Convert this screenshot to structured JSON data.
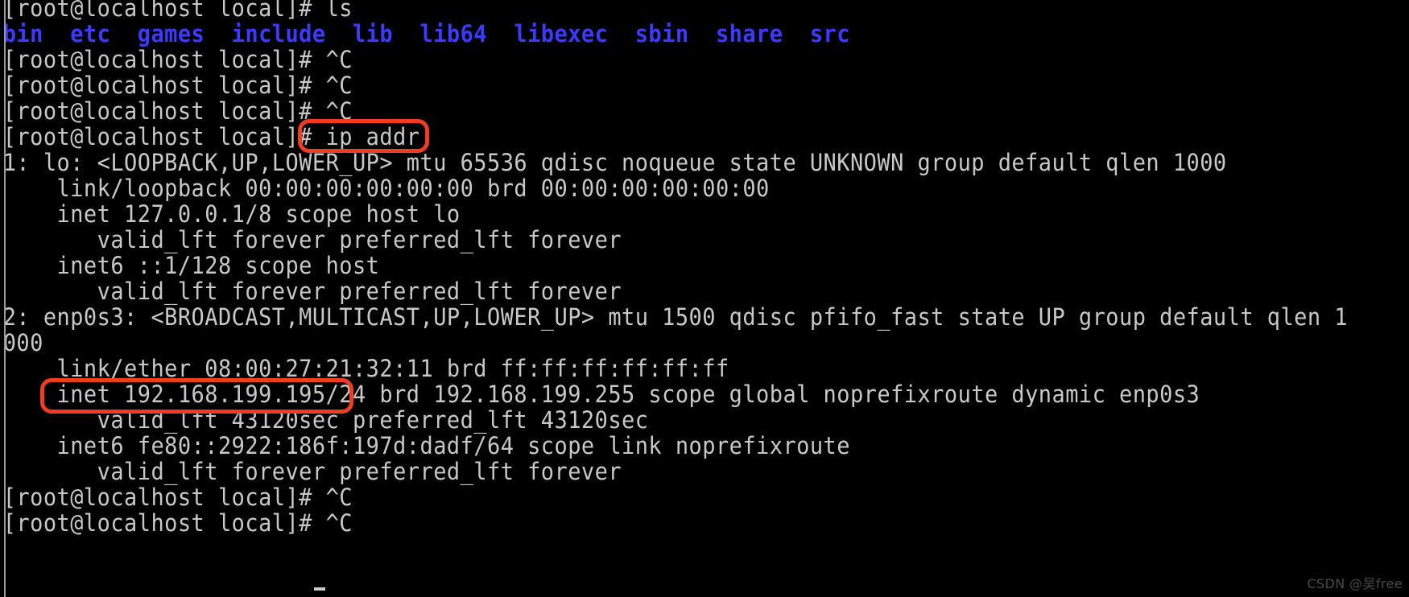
{
  "terminal": {
    "shell_prompt": "[root@localhost local]#",
    "background_color": "#000000",
    "foreground_color": "#c8c8c8",
    "directory_color": "#3b3bff",
    "highlight_color": "#f03c20",
    "lines": [
      {
        "id": "line-0",
        "type": "prompt",
        "text": "[root@localhost local]# ls"
      },
      {
        "id": "line-1",
        "type": "ls-output",
        "text": "bin  etc  games  include  lib  lib64  libexec  sbin  share  src"
      },
      {
        "id": "line-2",
        "type": "prompt",
        "text": "[root@localhost local]# ^C"
      },
      {
        "id": "line-3",
        "type": "prompt",
        "text": "[root@localhost local]# ^C"
      },
      {
        "id": "line-4",
        "type": "prompt",
        "text": "[root@localhost local]# ^C"
      },
      {
        "id": "line-5",
        "type": "prompt",
        "text": "[root@localhost local]# ip addr"
      },
      {
        "id": "line-6",
        "type": "output",
        "text": "1: lo: <LOOPBACK,UP,LOWER_UP> mtu 65536 qdisc noqueue state UNKNOWN group default qlen 1000"
      },
      {
        "id": "line-7",
        "type": "output",
        "text": "    link/loopback 00:00:00:00:00:00 brd 00:00:00:00:00:00"
      },
      {
        "id": "line-8",
        "type": "output",
        "text": "    inet 127.0.0.1/8 scope host lo"
      },
      {
        "id": "line-9",
        "type": "output",
        "text": "       valid_lft forever preferred_lft forever"
      },
      {
        "id": "line-10",
        "type": "output",
        "text": "    inet6 ::1/128 scope host"
      },
      {
        "id": "line-11",
        "type": "output",
        "text": "       valid_lft forever preferred_lft forever"
      },
      {
        "id": "line-12",
        "type": "output",
        "text": "2: enp0s3: <BROADCAST,MULTICAST,UP,LOWER_UP> mtu 1500 qdisc pfifo_fast state UP group default qlen 1"
      },
      {
        "id": "line-13",
        "type": "output",
        "text": "000"
      },
      {
        "id": "line-14",
        "type": "output",
        "text": "    link/ether 08:00:27:21:32:11 brd ff:ff:ff:ff:ff:ff"
      },
      {
        "id": "line-15",
        "type": "output",
        "text": "    inet 192.168.199.195/24 brd 192.168.199.255 scope global noprefixroute dynamic enp0s3"
      },
      {
        "id": "line-16",
        "type": "output",
        "text": "       valid_lft 43120sec preferred_lft 43120sec"
      },
      {
        "id": "line-17",
        "type": "output",
        "text": "    inet6 fe80::2922:186f:197d:dadf/64 scope link noprefixroute"
      },
      {
        "id": "line-18",
        "type": "output",
        "text": "       valid_lft forever preferred_lft forever"
      },
      {
        "id": "line-19",
        "type": "prompt",
        "text": "[root@localhost local]# ^C"
      },
      {
        "id": "line-20",
        "type": "prompt",
        "text": "[root@localhost local]# ^C"
      }
    ],
    "ls_entries": [
      "bin",
      "etc",
      "games",
      "include",
      "lib",
      "lib64",
      "libexec",
      "sbin",
      "share",
      "src"
    ],
    "command_executed": "ip addr"
  },
  "annotations": [
    {
      "id": "annot-cmd",
      "label": "ip addr",
      "color": "#f03c20"
    },
    {
      "id": "annot-ip",
      "label": "inet 192.168.199.195/24",
      "color": "#f03c20"
    }
  ],
  "network": {
    "interfaces": [
      {
        "index": "1",
        "name": "lo",
        "flags": "<LOOPBACK,UP,LOWER_UP>",
        "mtu": "65536",
        "qdisc": "noqueue",
        "state": "UNKNOWN",
        "group": "default",
        "qlen": "1000",
        "link_type": "link/loopback",
        "mac": "00:00:00:00:00:00",
        "brd_mac": "00:00:00:00:00:00",
        "inet": "127.0.0.1/8",
        "inet_scope": "host lo",
        "inet6": "::1/128",
        "inet6_scope": "host",
        "valid_lft": "forever",
        "preferred_lft": "forever"
      },
      {
        "index": "2",
        "name": "enp0s3",
        "flags": "<BROADCAST,MULTICAST,UP,LOWER_UP>",
        "mtu": "1500",
        "qdisc": "pfifo_fast",
        "state": "UP",
        "group": "default",
        "qlen": "1000",
        "link_type": "link/ether",
        "mac": "08:00:27:21:32:11",
        "brd_mac": "ff:ff:ff:ff:ff:ff",
        "inet": "192.168.199.195/24",
        "inet_brd": "192.168.199.255",
        "inet_scope": "global noprefixroute dynamic enp0s3",
        "inet6": "fe80::2922:186f:197d:dadf/64",
        "inet6_scope": "link noprefixroute",
        "valid_lft": "43120sec",
        "preferred_lft": "43120sec"
      }
    ]
  },
  "watermark": {
    "text": "CSDN @吴free"
  }
}
